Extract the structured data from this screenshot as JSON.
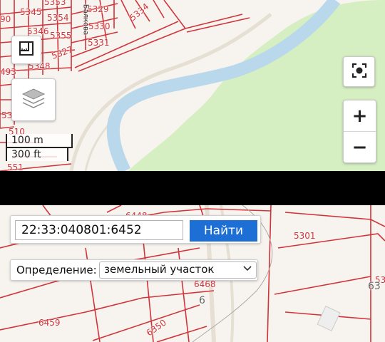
{
  "top_map": {
    "parcel_labels": [
      "5353",
      "5345",
      "5329",
      "5334",
      "5354",
      "5330",
      "5346",
      "5355",
      "5331",
      "5327",
      "5348",
      "5350",
      "493",
      "90",
      "510",
      "551"
    ],
    "street_label": "Балкова",
    "controls": {
      "ruler_icon": "ruler-icon",
      "layers_icon": "layers-icon",
      "locate_icon": "locate-target-icon",
      "zoom_in_label": "+",
      "zoom_out_label": "−"
    },
    "scale": {
      "metric": "100 m",
      "imperial": "300 ft"
    }
  },
  "bottom_map": {
    "search": {
      "value": "22:33:040801:6452",
      "button_label": "Найти"
    },
    "definition": {
      "label": "Определение:",
      "selected": "земельный участок"
    },
    "parcel_labels": [
      "6448",
      "5301",
      "6468",
      "6",
      "6459",
      "6350",
      "53",
      "63"
    ]
  },
  "colors": {
    "parcel_line": "#d0343a",
    "river": "#b9d8ec",
    "forest": "#d5eec2",
    "button_blue": "#1d6fd6"
  }
}
